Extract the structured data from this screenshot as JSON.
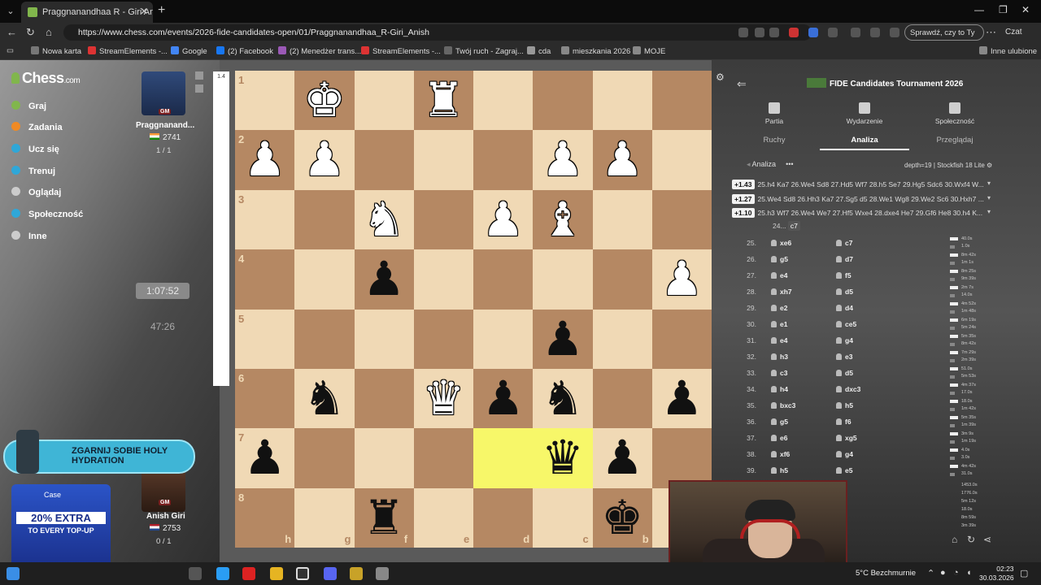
{
  "browser": {
    "tab_title": "Praggnanandhaa R - Giri Anish - T",
    "url": "https://www.chess.com/events/2026-fide-candidates-open/01/Praggnanandhaa_R-Giri_Anish",
    "check_label": "Sprawdź, czy to Ty",
    "chat_label": "Czat",
    "bookmarks": [
      "Nowa karta",
      "StreamElements -...",
      "Google",
      "(2) Facebook",
      "(2) Menedżer trans...",
      "StreamElements -...",
      "Twój ruch - Zagraj...",
      "cda",
      "mieszkania 2026",
      "MOJE"
    ],
    "other_bookmarks": "Inne ulubione",
    "bookmark_colors": [
      "#777",
      "#d33",
      "#4285f4",
      "#1877f2",
      "#9b59b6",
      "#d33",
      "#666",
      "#999",
      "#888",
      "#888"
    ]
  },
  "sidebar": {
    "logo": "Chess",
    "logo_suffix": ".com",
    "items": [
      {
        "label": "Graj",
        "color": "#81b64c"
      },
      {
        "label": "Zadania",
        "color": "#f08a24"
      },
      {
        "label": "Ucz się",
        "color": "#2fa7d8"
      },
      {
        "label": "Trenuj",
        "color": "#2fa7d8"
      },
      {
        "label": "Oglądaj",
        "color": "#cccccc"
      },
      {
        "label": "Społeczność",
        "color": "#2fa7d8"
      },
      {
        "label": "Inne",
        "color": "#cccccc"
      }
    ]
  },
  "players": {
    "top": {
      "name": "Praggnanand...",
      "title": "GM",
      "rating": "2741",
      "score": "1 / 1",
      "clock": "1:07:52"
    },
    "bottom": {
      "name": "Anish Giri",
      "title": "GM",
      "rating": "2753",
      "score": "0 / 1",
      "clock": "47:26"
    }
  },
  "eval_bar": {
    "value": "1.4"
  },
  "board": {
    "files": [
      "h",
      "g",
      "f",
      "e",
      "d",
      "c",
      "b",
      "a"
    ],
    "ranks": [
      "1",
      "2",
      "3",
      "4",
      "5",
      "6",
      "7",
      "8"
    ],
    "light_color": "#f0d9b5",
    "dark_color": "#b58863",
    "highlight_color": "#f7f769",
    "highlight_squares": [
      "d7",
      "c7"
    ],
    "pieces": [
      {
        "square": "g1",
        "glyph": "♚",
        "side": "white"
      },
      {
        "square": "e1",
        "glyph": "♜",
        "side": "white"
      },
      {
        "square": "h2",
        "glyph": "♟",
        "side": "white"
      },
      {
        "square": "g2",
        "glyph": "♟",
        "side": "white"
      },
      {
        "square": "c2",
        "glyph": "♟",
        "side": "white"
      },
      {
        "square": "b2",
        "glyph": "♟",
        "side": "white"
      },
      {
        "square": "f3",
        "glyph": "♞",
        "side": "white"
      },
      {
        "square": "d3",
        "glyph": "♟",
        "side": "white"
      },
      {
        "square": "c3",
        "glyph": "♝",
        "side": "white"
      },
      {
        "square": "a4",
        "glyph": "♟",
        "side": "white"
      },
      {
        "square": "f4",
        "glyph": "♟",
        "side": "black"
      },
      {
        "square": "c5",
        "glyph": "♟",
        "side": "black"
      },
      {
        "square": "g6",
        "glyph": "♞",
        "side": "black"
      },
      {
        "square": "e6",
        "glyph": "♛",
        "side": "white"
      },
      {
        "square": "d6",
        "glyph": "♟",
        "side": "black"
      },
      {
        "square": "c6",
        "glyph": "♞",
        "side": "black"
      },
      {
        "square": "a6",
        "glyph": "♟",
        "side": "black"
      },
      {
        "square": "h7",
        "glyph": "♟",
        "side": "black"
      },
      {
        "square": "c7",
        "glyph": "♛",
        "side": "black"
      },
      {
        "square": "b7",
        "glyph": "♟",
        "side": "black"
      },
      {
        "square": "f8",
        "glyph": "♜",
        "side": "black"
      },
      {
        "square": "b8",
        "glyph": "♚",
        "side": "black"
      }
    ]
  },
  "panel": {
    "title": "FIDE Candidates Tournament 2026",
    "icon_tabs": [
      "Partia",
      "Wydarzenie",
      "Społeczność"
    ],
    "sub_tabs": [
      "Ruchy",
      "Analiza",
      "Przeglądaj"
    ],
    "analysis_label": "Analiza",
    "depth": "depth=19 | Stockfish 18 Lite",
    "lines": [
      {
        "score": "+1.43",
        "moves": "25.h4 Ka7 26.We4 Sd8 27.Hd5 Wf7 28.h5 Se7 29.Hg5 Sdc6 30.Wxf4 W..."
      },
      {
        "score": "+1.27",
        "moves": "25.We4 Sd8 26.Hh3 Ka7 27.Sg5 d5 28.We1 Wg8 29.We2 Sc6 30.Hxh7 ..."
      },
      {
        "score": "+1.10",
        "moves": "25.h3 Wf7 26.We4 We7 27.Hf5 Wxe4 28.dxe4 He7 29.Gf6 He8 30.h4 K..."
      }
    ],
    "current": {
      "num": "24...",
      "move": "c7"
    },
    "moves": [
      {
        "no": "25.",
        "w": "xe6",
        "b": "c7",
        "t1": "40.0s",
        "t2": "1.0s"
      },
      {
        "no": "26.",
        "w": "g5",
        "b": "d7",
        "t1": "8m 42s",
        "t2": "1m 1s"
      },
      {
        "no": "27.",
        "w": "e4",
        "b": "f5",
        "t1": "8m 25s",
        "t2": "9m 39s"
      },
      {
        "no": "28.",
        "w": "xh7",
        "b": "d5",
        "t1": "2m 7s",
        "t2": "14.0s"
      },
      {
        "no": "29.",
        "w": "e2",
        "b": "d4",
        "t1": "4m 52s",
        "t2": "1m 48s"
      },
      {
        "no": "30.",
        "w": "e1",
        "b": "ce5",
        "t1": "6m 19s",
        "t2": "5m 24s"
      },
      {
        "no": "31.",
        "w": "e4",
        "b": "g4",
        "t1": "5m 35s",
        "t2": "8m 42s"
      },
      {
        "no": "32.",
        "w": "h3",
        "b": "e3",
        "t1": "7m 29s",
        "t2": "2m 39s"
      },
      {
        "no": "33.",
        "w": "c3",
        "b": "d5",
        "t1": "51.0s",
        "t2": "5m 53s"
      },
      {
        "no": "34.",
        "w": "h4",
        "b": "dxc3",
        "t1": "4m 37s",
        "t2": "17.0s"
      },
      {
        "no": "35.",
        "w": "bxc3",
        "b": "h5",
        "t1": "18.0s",
        "t2": "1m 42s"
      },
      {
        "no": "36.",
        "w": "g5",
        "b": "f6",
        "t1": "5m 35s",
        "t2": "1m 39s"
      },
      {
        "no": "37.",
        "w": "e6",
        "b": "xg5",
        "t1": "3m 9s",
        "t2": "1m 19s"
      },
      {
        "no": "38.",
        "w": "xf6",
        "b": "g4",
        "t1": "4.0s",
        "t2": "3.0s"
      },
      {
        "no": "39.",
        "w": "h5",
        "b": "e5",
        "t1": "4m 42s",
        "t2": "31.0s"
      }
    ],
    "extra_times": [
      "1453.0s",
      "1776.0s",
      "5m 12s",
      "18.0s",
      "8m 59s",
      "3m 39s"
    ]
  },
  "ads": {
    "top": "ZGARNIJ SOBIE HOLY HYDRATION",
    "bottom_brand": "Case",
    "bottom_big": "20% EXTRA",
    "bottom_small": "TO EVERY TOP-UP"
  },
  "taskbar": {
    "weather": "5°C  Bezchmurnie",
    "time": "02:23",
    "date": "30.03.2026"
  }
}
